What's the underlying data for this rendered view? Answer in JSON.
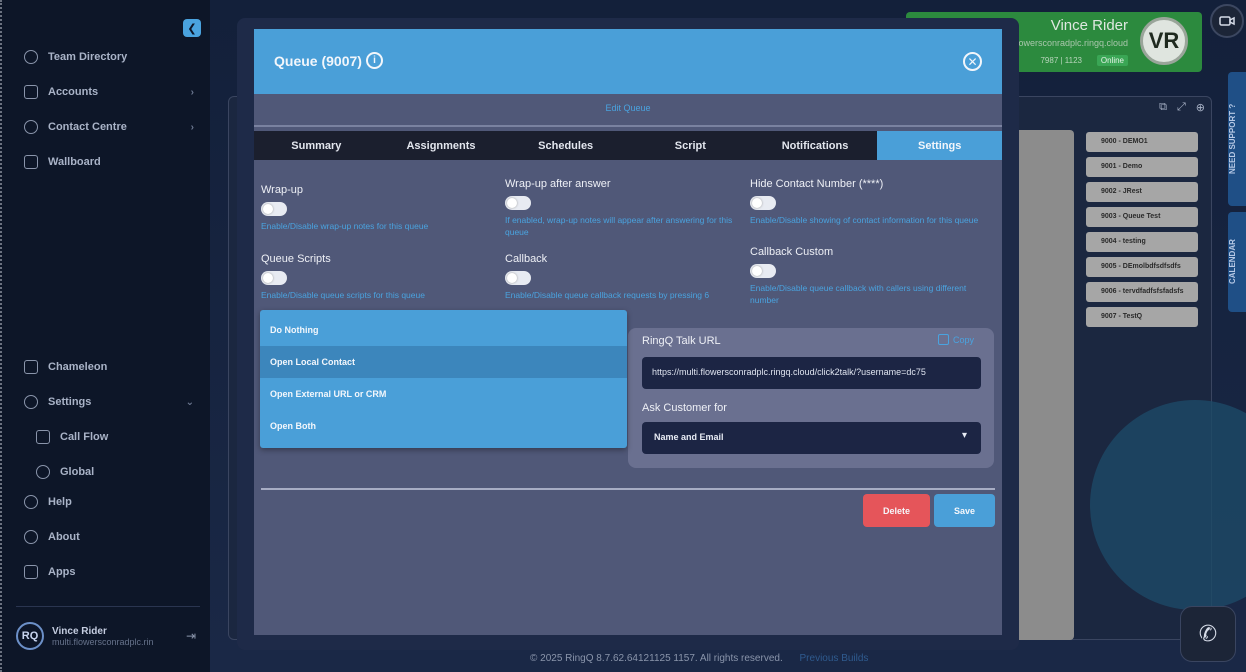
{
  "sidebar": {
    "items": [
      {
        "label": "Team Directory"
      },
      {
        "label": "Accounts"
      },
      {
        "label": "Contact Centre"
      },
      {
        "label": "Wallboard"
      },
      {
        "label": "Chameleon"
      },
      {
        "label": "Settings"
      },
      {
        "label": "Call Flow"
      },
      {
        "label": "Global"
      },
      {
        "label": "Help"
      },
      {
        "label": "About"
      },
      {
        "label": "Apps"
      }
    ],
    "user": {
      "initials": "RQ",
      "name": "Vince Rider",
      "sub": "multi.flowersconradplc.rin"
    }
  },
  "header": {
    "user_name": "Vince Rider",
    "user_email": "flowersconradplc.ringq.cloud",
    "extension": "7987 | 1123",
    "status": "Online",
    "avatar_initials": "VR"
  },
  "side_tabs": {
    "support": "NEED SUPPORT ?",
    "calendar": "CALENDAR"
  },
  "queues": [
    "9000 - DEMO1",
    "9001 - Demo",
    "9002 - JRest",
    "9003 - Queue Test",
    "9004 - testing",
    "9005 - DEmolbdfsdfsdfs",
    "9006 - tervdfadfsfsfadsfs",
    "9007 - TestQ"
  ],
  "footer": {
    "copyright": "© 2025 RingQ 8.7.62.64121125 1157. All rights reserved.",
    "link": "Previous Builds"
  },
  "modal": {
    "title": "Queue (9007)",
    "subtitle": "Edit Queue",
    "tabs": [
      "Summary",
      "Assignments",
      "Schedules",
      "Script",
      "Notifications",
      "Settings"
    ],
    "active_tab": "Settings",
    "fields": {
      "wrapup": {
        "label": "Wrap-up",
        "hint": "Enable/Disable wrap-up notes for this queue"
      },
      "wrapup_after": {
        "label": "Wrap-up after answer",
        "hint": "If enabled, wrap-up notes will appear after answering for this queue"
      },
      "hide_number": {
        "label": "Hide Contact Number (****)",
        "hint": "Enable/Disable showing of contact information for this queue"
      },
      "queue_scripts": {
        "label": "Queue Scripts",
        "hint": "Enable/Disable queue scripts for this queue"
      },
      "callback": {
        "label": "Callback",
        "hint": "Enable/Disable queue callback requests by pressing 6"
      },
      "callback_custom": {
        "label": "Callback Custom",
        "hint": "Enable/Disable queue callback with callers using different number"
      }
    },
    "dropdown_options": [
      "Do Nothing",
      "Open Local Contact",
      "Open External URL or CRM",
      "Open Both"
    ],
    "highlighted_option": "Open Local Contact",
    "ringq": {
      "title": "RingQ Talk URL",
      "copy_label": "Copy",
      "url": "https://multi.flowersconradplc.ringq.cloud/click2talk/?username=dc75",
      "ask_label": "Ask Customer for",
      "ask_value": "Name and Email"
    },
    "buttons": {
      "delete": "Delete",
      "save": "Save"
    }
  },
  "colors": {
    "accent": "#4a9fd8",
    "danger": "#e5555a",
    "online": "#2c8a3e",
    "modal_bg": "#505878"
  }
}
